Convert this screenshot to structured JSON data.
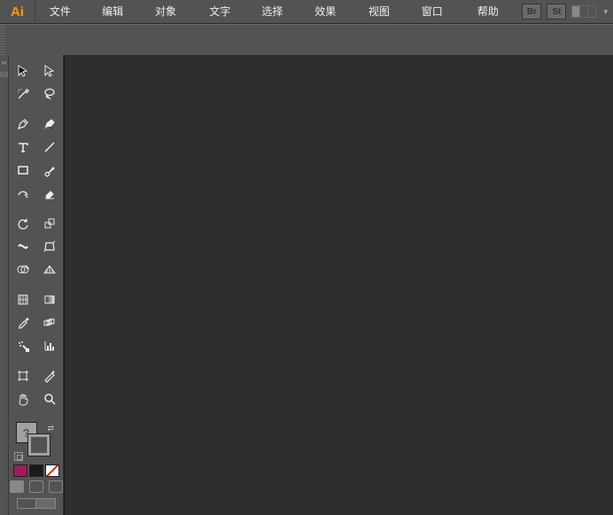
{
  "app": {
    "logo": "Ai"
  },
  "menu": {
    "file": "文件(F)",
    "edit": "编辑(E)",
    "object": "对象(O)",
    "type": "文字(T)",
    "select": "选择(S)",
    "effect": "效果(C)",
    "view": "视图(V)",
    "window": "窗口(W)",
    "help": "帮助(H)"
  },
  "topright": {
    "br": "Br",
    "st": "St"
  },
  "swatch": {
    "fill_unknown": "?"
  },
  "colors": {
    "fill": "#a01c5d",
    "stroke_black": "#1a1a1a",
    "none": "linear"
  }
}
